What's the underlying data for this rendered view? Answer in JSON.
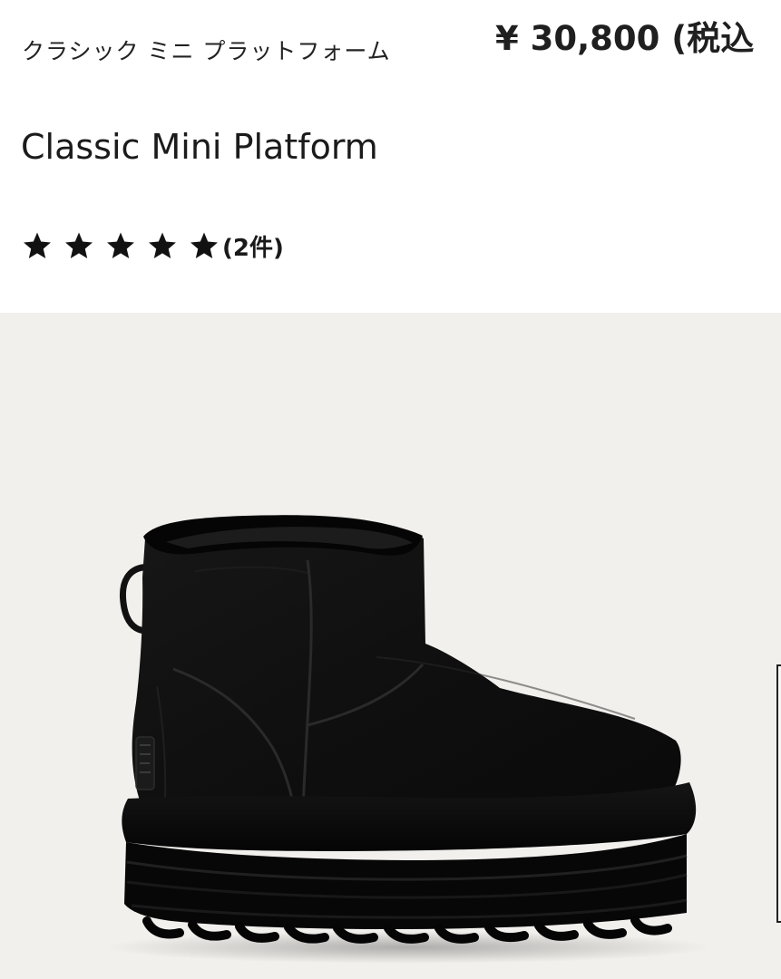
{
  "product": {
    "name_ja": "クラシック ミニ プラットフォーム",
    "price": "¥ 30,800 (税込",
    "name_en": "Classic Mini Platform",
    "rating": {
      "stars": 5,
      "review_count": "(2件)"
    }
  },
  "image": {
    "description_icon": "boot-product-image",
    "background_color": "#f2f0ed",
    "product_color": "#111111"
  },
  "icons": {
    "star": "star-icon"
  }
}
